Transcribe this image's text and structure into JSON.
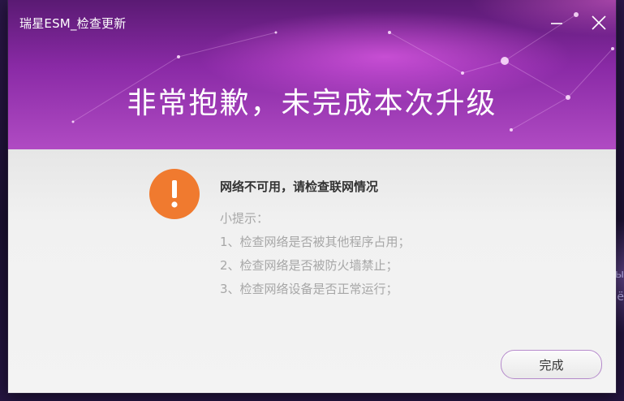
{
  "window": {
    "title": "瑞星ESM_检查更新",
    "minimize_icon": "minimize-icon",
    "close_icon": "close-icon"
  },
  "header": {
    "headline": "非常抱歉，未完成本次升级"
  },
  "message": {
    "icon": "warning-icon",
    "icon_color": "#f07a2f",
    "title": "网络不可用，请检查联网情况",
    "tips_heading": "小提示：",
    "tips": [
      "1、检查网络是否被其他程序占用；",
      "2、检查网络是否被防火墙禁止；",
      "3、检查网络设备是否正常运行；"
    ]
  },
  "actions": {
    "finish_label": "完成"
  },
  "colors": {
    "header_top": "#5a1a73",
    "header_bottom": "#b04bc3",
    "button_border": "#b58acb",
    "tip_text": "#a7a7a7"
  }
}
